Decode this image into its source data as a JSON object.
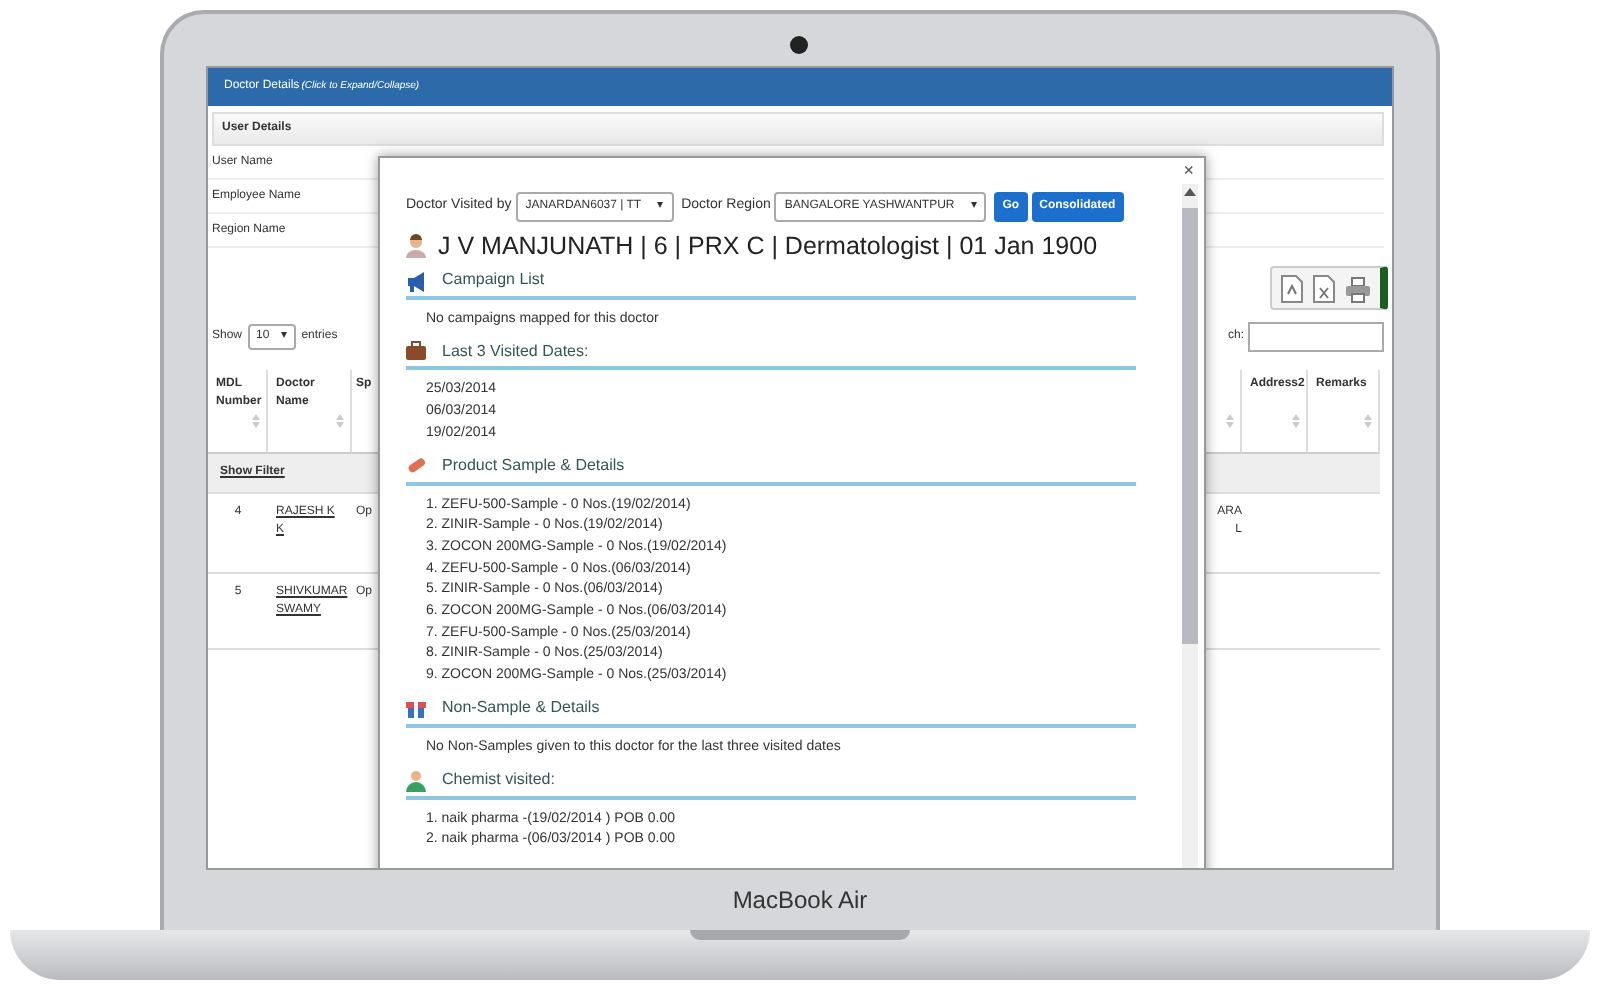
{
  "device": {
    "label": "MacBook Air"
  },
  "panel": {
    "title": "Doctor Details",
    "hint": "(Click to Expand/Collapse)"
  },
  "user_details": {
    "title": "User Details",
    "fields": [
      {
        "label": "User Name"
      },
      {
        "label": "Employee Name"
      },
      {
        "label": "Region Name"
      }
    ]
  },
  "length_menu": {
    "before": "Show",
    "value": "10",
    "caret": "▾",
    "after": "entries"
  },
  "search": {
    "label": "ch:"
  },
  "table": {
    "columns": [
      "MDL Number",
      "Doctor Name",
      "Sp",
      "",
      "Address2",
      "Remarks"
    ],
    "filter_link": "Show Filter",
    "rows": [
      {
        "mdl": "4",
        "doctor": "RAJESH K K",
        "column_3": "Op",
        "column_4": [
          "ARA",
          "L"
        ]
      },
      {
        "mdl": "5",
        "doctor": "SHIVKUMAR SWAMY",
        "column_3": "Op",
        "column_4": []
      }
    ]
  },
  "modal": {
    "close": "×",
    "filters": [
      {
        "label": "Doctor Visited by",
        "value": "JANARDAN6037 | TT",
        "caret": "▾"
      },
      {
        "label": "Doctor Region",
        "value": "BANGALORE YASHWANTPUR",
        "caret": "▾"
      }
    ],
    "buttons": [
      "Go",
      "Consolidated"
    ],
    "doctor": "J V MANJUNATH | 6 | PRX C | Dermatologist | 01 Jan 1900",
    "sections": [
      {
        "kind": "campaign",
        "title": "Campaign List",
        "lines": [
          "No campaigns mapped for this doctor"
        ]
      },
      {
        "kind": "visits",
        "title": "Last 3 Visited Dates:",
        "lines": [
          "25/03/2014",
          "06/03/2014",
          "19/02/2014"
        ]
      },
      {
        "kind": "samples",
        "title": "Product Sample & Details",
        "lines": [
          "1. ZEFU-500-Sample - 0 Nos.(19/02/2014)",
          "2. ZINIR-Sample - 0 Nos.(19/02/2014)",
          "3. ZOCON 200MG-Sample - 0 Nos.(19/02/2014)",
          "4. ZEFU-500-Sample - 0 Nos.(06/03/2014)",
          "5. ZINIR-Sample - 0 Nos.(06/03/2014)",
          "6. ZOCON 200MG-Sample - 0 Nos.(06/03/2014)",
          "7. ZEFU-500-Sample - 0 Nos.(25/03/2014)",
          "8. ZINIR-Sample - 0 Nos.(25/03/2014)",
          "9. ZOCON 200MG-Sample - 0 Nos.(25/03/2014)"
        ]
      },
      {
        "kind": "non_samples",
        "title": "Non-Sample & Details",
        "lines": [
          "No Non-Samples given to this doctor for the last three visited dates"
        ]
      },
      {
        "kind": "chemist",
        "title": "Chemist visited:",
        "lines": [
          "1. naik pharma -(19/02/2014 ) POB 0.00",
          "2. naik pharma -(06/03/2014 ) POB 0.00"
        ]
      }
    ]
  }
}
